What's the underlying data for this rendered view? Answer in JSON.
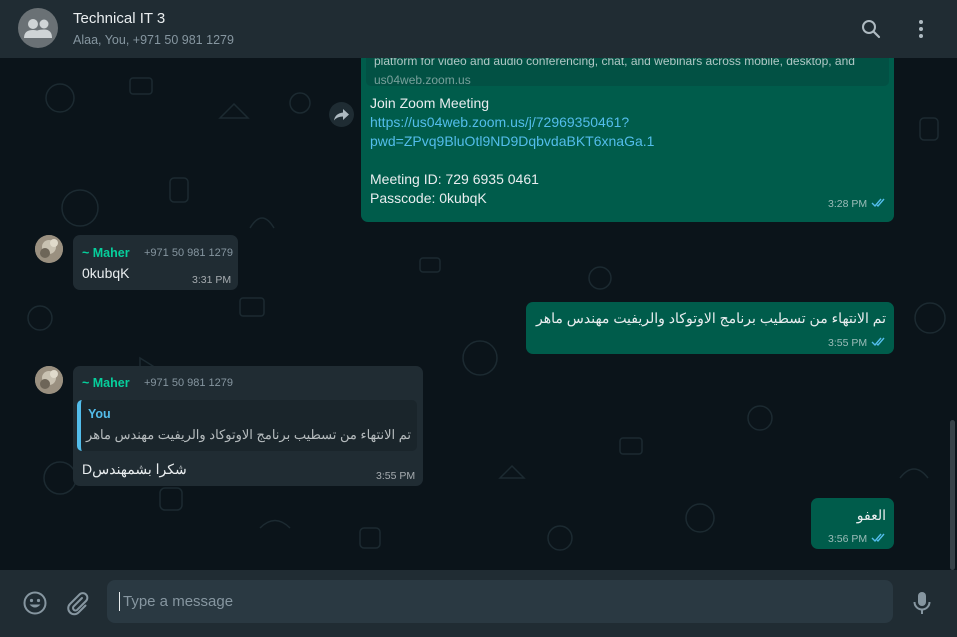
{
  "header": {
    "title": "Technical IT 3",
    "participants": "Alaa, You, +971 50 981 1279"
  },
  "messages": {
    "zoom": {
      "preview_desc": "platform for video and audio conferencing, chat, and webinars across mobile, desktop, and",
      "preview_domain": "us04web.zoom.us",
      "line1": "Join Zoom Meeting",
      "link_part1": "https://us04web.zoom.us/j/72969350461?",
      "link_part2": "pwd=ZPvq9BluOtl9ND9DqbvdaBKT6xnaGa.1",
      "meeting_id": "Meeting ID: 729 6935 0461",
      "passcode": "Passcode: 0kubqK",
      "time": "3:28 PM"
    },
    "maher1": {
      "sender": "~ Maher",
      "phone": "+971 50 981 1279",
      "text": "0kubqK",
      "time": "3:31 PM"
    },
    "out1": {
      "text": "تم الانتهاء من تسطيب برنامج الاوتوكاد والريفيت مهندس ماهر",
      "time": "3:55 PM"
    },
    "maher2": {
      "sender": "~ Maher",
      "phone": "+971 50 981 1279",
      "quote_author": "You",
      "quote_text": "تم الانتهاء من تسطيب برنامج الاوتوكاد والريفيت مهندس ماهر",
      "text": "شكرا بشمهندسD",
      "time": "3:55 PM"
    },
    "out2": {
      "text": "العفو",
      "time": "3:56 PM"
    }
  },
  "composer": {
    "placeholder": "Type a message"
  },
  "colors": {
    "outgoing": "#005c4b",
    "incoming": "#202c33",
    "accent": "#06cf9c",
    "link": "#53bdeb",
    "read_tick": "#53bdeb"
  },
  "icons": [
    "group-avatar-icon",
    "search-icon",
    "menu-icon",
    "forward-icon",
    "emoji-icon",
    "attach-icon",
    "mic-icon",
    "double-tick-icon"
  ]
}
